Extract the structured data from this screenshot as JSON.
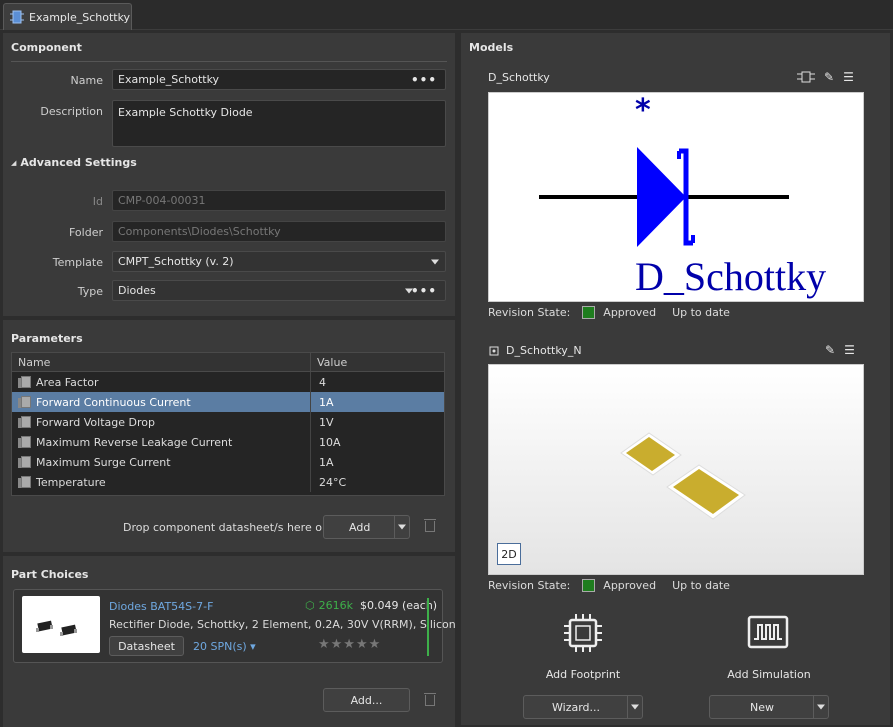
{
  "tab": {
    "label": "Example_Schottky"
  },
  "component": {
    "title": "Component",
    "name_label": "Name",
    "name_value": "Example_Schottky",
    "description_label": "Description",
    "description_value": "Example Schottky Diode",
    "advanced_label": "Advanced Settings",
    "id_label": "Id",
    "id_value": "CMP-004-00031",
    "folder_label": "Folder",
    "folder_value": "Components\\Diodes\\Schottky",
    "template_label": "Template",
    "template_value": "CMPT_Schottky (v. 2)",
    "type_label": "Type",
    "type_value": "Diodes"
  },
  "parameters": {
    "title": "Parameters",
    "col_name": "Name",
    "col_value": "Value",
    "rows": [
      {
        "name": "Area Factor",
        "value": "4"
      },
      {
        "name": "Forward Continuous Current",
        "value": "1A"
      },
      {
        "name": "Forward Voltage Drop",
        "value": "1V"
      },
      {
        "name": "Maximum Reverse Leakage Current",
        "value": "10A"
      },
      {
        "name": "Maximum Surge Current",
        "value": "1A"
      },
      {
        "name": "Temperature",
        "value": "24°C"
      }
    ],
    "drop_text": "Drop component datasheet/s here or",
    "add_label": "Add"
  },
  "part_choices": {
    "title": "Part Choices",
    "part_name": "Diodes BAT54S-7-F",
    "stock": "2616k",
    "price": "$0.049 (each)",
    "description": "Rectifier Diode, Schottky, 2 Element, 0.2A, 30V V(RRM), Silicon",
    "datasheet_label": "Datasheet",
    "spn_label": "20 SPN(s) ▾",
    "stars": "★★★★★",
    "add_label": "Add..."
  },
  "models": {
    "title": "Models",
    "symbol": {
      "name": "D_Schottky",
      "designator": "*",
      "big_text": "D_Schottky",
      "revision_label": "Revision State:",
      "state": "Approved",
      "status": "Up to date"
    },
    "footprint": {
      "name": "D_Schottky_N",
      "view_label": "2D",
      "revision_label": "Revision State:",
      "state": "Approved",
      "status": "Up to date"
    },
    "add_footprint_label": "Add Footprint",
    "add_simulation_label": "Add Simulation",
    "wizard_label": "Wizard...",
    "new_label": "New"
  },
  "colors": {
    "selected_row": "#5b7da3",
    "approved": "#1e7d1e",
    "symbol_blue": "#0000ff",
    "pad": "#c9ad2e"
  },
  "icons": [
    "component-icon",
    "edit-icon",
    "menu-icon",
    "pin-map-icon",
    "footprint-chip-icon",
    "simulation-icon",
    "trash-icon",
    "cube-icon"
  ]
}
